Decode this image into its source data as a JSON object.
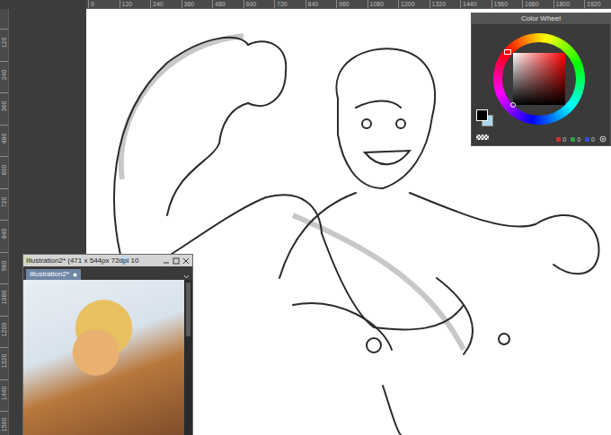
{
  "rulers": {
    "top": [
      "0",
      "120",
      "240",
      "360",
      "480",
      "600",
      "720",
      "840",
      "960",
      "1080",
      "1200",
      "1320",
      "1440",
      "1560",
      "1680",
      "1800",
      "1920"
    ],
    "left": [
      "120",
      "240",
      "360",
      "480",
      "600",
      "720",
      "840",
      "960",
      "1080",
      "1200",
      "1320",
      "1440",
      "1560"
    ]
  },
  "color_wheel": {
    "title": "Color Wheel",
    "hue": 0,
    "saturation": 0,
    "value": 0,
    "swatches": [
      {
        "color": "#000000",
        "selected": true
      },
      {
        "color": "#a9d6ea",
        "selected": false
      }
    ],
    "readout": [
      {
        "value": "0",
        "color": "#d03030"
      },
      {
        "value": "0",
        "color": "#30a040"
      },
      {
        "value": "0",
        "color": "#3050d0"
      }
    ]
  },
  "sub_window": {
    "title": "Illustration2* (471 x 544px 72dpi 10",
    "tab": {
      "label": "Illustration2*",
      "selected": true
    }
  }
}
